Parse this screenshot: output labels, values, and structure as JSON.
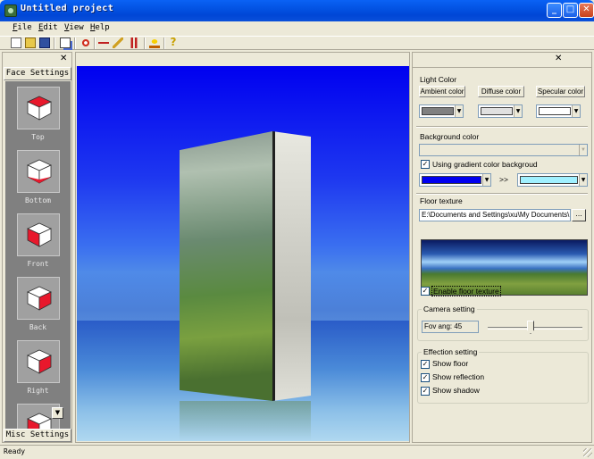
{
  "window": {
    "title": "Untitled project"
  },
  "menu": [
    "File",
    "Edit",
    "View",
    "Help"
  ],
  "left_panel": {
    "header": "Face Settings",
    "footer": "Misc Settings",
    "faces": [
      {
        "label": "Top",
        "highlight": "top"
      },
      {
        "label": "Bottom",
        "highlight": "bottom"
      },
      {
        "label": "Front",
        "highlight": "front"
      },
      {
        "label": "Back",
        "highlight": "back"
      },
      {
        "label": "Right",
        "highlight": "right"
      },
      {
        "label": "",
        "highlight": "left"
      }
    ]
  },
  "right_panel": {
    "light_color": {
      "title": "Light Color",
      "ambient_label": "Ambient color",
      "diffuse_label": "Diffuse color",
      "specular_label": "Specular color",
      "ambient_color": "#808080",
      "diffuse_color": "#e0e0e0",
      "specular_color": "#ffffff"
    },
    "background": {
      "title": "Background color",
      "gradient_label": "Using gradient color backgroud",
      "gradient_checked": true,
      "arrow": ">>",
      "color_from": "#0000f0",
      "color_to": "#a0f0ff"
    },
    "floor": {
      "title": "Floor texture",
      "path": "E:\\Documents and Settings\\xu\\My Documents\\",
      "browse_label": "...",
      "enable_label": "Enable floor texture",
      "enable_checked": true
    },
    "camera": {
      "title": "Camera setting",
      "fov_text": "Fov ang: 45"
    },
    "effects": {
      "title": "Effection setting",
      "show_floor": "Show floor",
      "show_reflection": "Show reflection",
      "show_shadow": "Show shadow"
    }
  },
  "status": {
    "text": "Ready"
  }
}
